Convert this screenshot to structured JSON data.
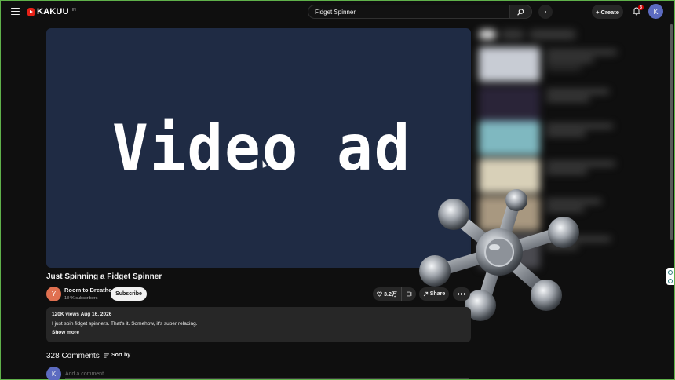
{
  "header": {
    "logo_text": "KAKUU",
    "logo_sup": "IN",
    "search_value": "Fidget Spinner",
    "search_icon": "search-icon",
    "create_label": "Create",
    "notification_count": "3",
    "avatar_letter": "K"
  },
  "player": {
    "overlay_text": "Video ad"
  },
  "video": {
    "title": "Just Spinning a Fidget Spinner",
    "channel_avatar_letter": "Y",
    "channel_name": "Room to Breathe",
    "subscribers": "184K subscribers",
    "subscribe_label": "Subscribe",
    "likes": "3.2万",
    "share_label": "Share"
  },
  "description": {
    "meta": "120K views  Aug 16, 2026",
    "text": "I just spin fidget spinners. That's it. Somehow, it's super relaxing.",
    "show_more": "Show more"
  },
  "comments": {
    "count_label": "328 Comments",
    "sort_label": "Sort by",
    "avatar_letter": "K",
    "placeholder": "Add a comment..."
  },
  "colors": {
    "background": "#0f0f0f",
    "player_bg": "#1f2b44",
    "accent_red": "#e62117",
    "channel_avatar": "#e07050",
    "user_avatar": "#5c6bc0"
  }
}
